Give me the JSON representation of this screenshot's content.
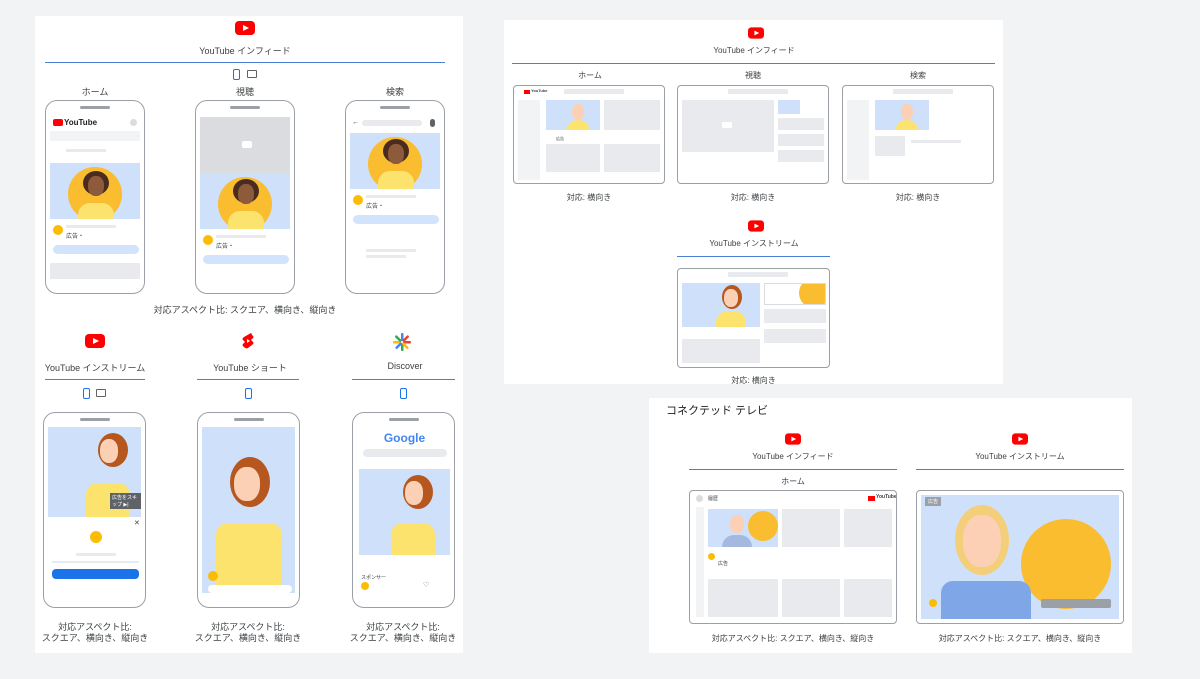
{
  "left_panel": {
    "top_section": {
      "title": "YouTube インフィード",
      "columns": [
        {
          "label": "ホーム"
        },
        {
          "label": "視聴"
        },
        {
          "label": "検索"
        }
      ],
      "youtube_wordmark": "YouTube",
      "ad_label": "広告・",
      "aspect_caption": "対応アスペクト比: スクエア、横向き、縦向き"
    },
    "bottom_section": {
      "columns": [
        {
          "title": "YouTube インストリーム",
          "caption_l1": "対応アスペクト比:",
          "caption_l2": "スクエア、横向き、縦向き",
          "skip_label": "広告をスキップ ▶|"
        },
        {
          "title": "YouTube ショート",
          "caption_l1": "対応アスペクト比:",
          "caption_l2": "スクエア、横向き、縦向き"
        },
        {
          "title": "Discover",
          "caption_l1": "対応アスペクト比:",
          "caption_l2": "スクエア、横向き、縦向き",
          "google_logo": "Google",
          "sponsor_label": "スポンサー"
        }
      ]
    }
  },
  "desktop_panel": {
    "title": "YouTube インフィード",
    "columns": [
      {
        "label": "ホーム",
        "caption": "対応: 横向き"
      },
      {
        "label": "視聴",
        "caption": "対応: 横向き"
      },
      {
        "label": "検索",
        "caption": "対応: 横向き"
      }
    ],
    "youtube_wordmark": "YouTube",
    "ad_label": "広告",
    "instream_title": "YouTube インストリーム",
    "instream_caption": "対応: 横向き"
  },
  "tv_panel": {
    "heading": "コネクテッド テレビ",
    "infeed_title": "YouTube インフィード",
    "instream_title": "YouTube インストリーム",
    "home_label": "ホーム",
    "home_screen_label": "履歴",
    "youtube_wordmark": "YouTube",
    "ad_label": "広告",
    "ad_tag": "広告",
    "caption_left": "対応アスペクト比: スクエア、横向き、縦向き",
    "caption_right": "対応アスペクト比: スクエア、横向き、縦向き"
  },
  "colors": {
    "background": "#f1f3f4",
    "youtube_red": "#ff0000",
    "accent_blue": "#4a7fd8",
    "sun_yellow": "#f9bd2f",
    "sky_blue": "#cfe0fb"
  }
}
